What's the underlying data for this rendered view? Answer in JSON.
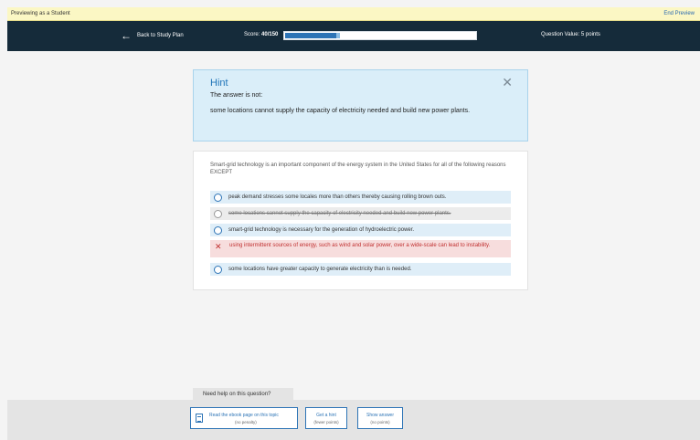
{
  "preview_bar": {
    "left_text": "Previewing as a Student",
    "end_label": "End Preview"
  },
  "header": {
    "back_label": "Back to Study Plan",
    "score_prefix": "Score:",
    "score_value": "40/150",
    "score_earned_fraction": 0.267,
    "score_pending_fraction": 0.02,
    "question_value": "Question Value: 5 points"
  },
  "hint": {
    "title": "Hint",
    "subtitle": "The answer is not:",
    "text": "some locations cannot supply the capacity of electricity needed and build new power plants."
  },
  "question": {
    "text": "Smart-grid technology is an important component of the energy system in the United States for all of the following reasons EXCEPT",
    "options": [
      {
        "label": "peak demand stresses some locales more than others thereby causing rolling brown outs.",
        "state": "default"
      },
      {
        "label": "some locations cannot supply the capacity of electricity needed and build new power plants.",
        "state": "eliminated"
      },
      {
        "label": "smart-grid technology is necessary for the generation of hydroelectric power.",
        "state": "default"
      },
      {
        "label": "using intermittent sources of energy, such as wind and solar power, over a wide-scale can lead to instability.",
        "state": "incorrect"
      },
      {
        "label": "some locations have greater capacity to generate electricity than is needed.",
        "state": "default"
      }
    ]
  },
  "help": {
    "label": "Need help on this question?",
    "ebook": {
      "label": "Read the ebook page on this topic",
      "sub": "(no penalty)"
    },
    "hint": {
      "label": "Get a hint",
      "sub": "(fewer points)"
    },
    "answer": {
      "label": "Show answer",
      "sub": "(no points)"
    }
  },
  "colors": {
    "accent": "#2d74b6",
    "header_bg": "#152b3a",
    "hint_bg": "#daeef9",
    "wrong": "#c03030"
  },
  "icons": [
    "back-arrow-icon",
    "close-icon",
    "radio-icon",
    "incorrect-x-icon",
    "ebook-icon"
  ]
}
